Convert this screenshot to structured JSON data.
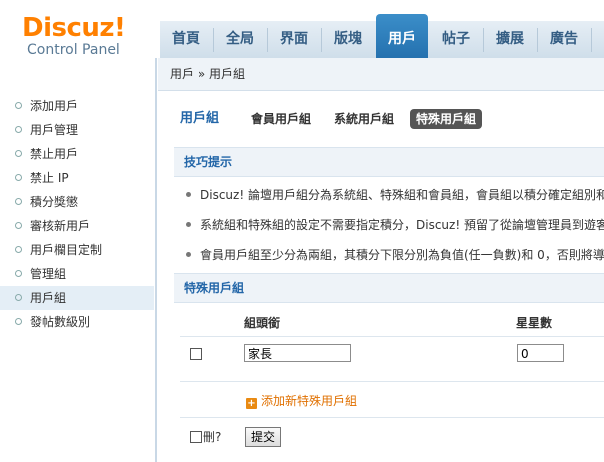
{
  "logo": {
    "title": "Discuz!",
    "subtitle": "Control Panel"
  },
  "nav": {
    "items": [
      {
        "label": "首頁"
      },
      {
        "label": "全局"
      },
      {
        "label": "界面"
      },
      {
        "label": "版塊"
      },
      {
        "label": "用戶",
        "active": true
      },
      {
        "label": "帖子"
      },
      {
        "label": "擴展"
      },
      {
        "label": "廣告"
      }
    ]
  },
  "breadcrumb": "用戶 » 用戶組",
  "sidebar": {
    "items": [
      {
        "label": "添加用戶"
      },
      {
        "label": "用戶管理"
      },
      {
        "label": "禁止用戶"
      },
      {
        "label": "禁止 IP"
      },
      {
        "label": "積分獎懲"
      },
      {
        "label": "審核新用戶"
      },
      {
        "label": "用戶欄目定制"
      },
      {
        "label": "管理組"
      },
      {
        "label": "用戶組",
        "active": true
      },
      {
        "label": "發帖數級別"
      }
    ]
  },
  "tabs": {
    "title": "用戶組",
    "items": [
      {
        "label": "會員用戶組"
      },
      {
        "label": "系統用戶組"
      },
      {
        "label": "特殊用戶組",
        "active": true
      }
    ]
  },
  "tips": {
    "heading": "技巧提示",
    "items": [
      "Discuz! 論壇用戶組分為系統組、特殊組和會員組，會員組以積分確定組別和",
      "系統組和特殊組的設定不需要指定積分，Discuz! 預留了從論壇管理員到遊客",
      "會員用戶組至少分為兩組，其積分下限分別為負值(任一負數)和 0，否則將導"
    ]
  },
  "special_groups": {
    "heading": "特殊用戶組",
    "columns": {
      "title": "組頭銜",
      "stars": "星星數"
    },
    "rows": [
      {
        "title": "家長",
        "stars": "0"
      }
    ],
    "add_label": "添加新特殊用戶組",
    "delete_label": "刪?",
    "submit_label": "提交"
  }
}
